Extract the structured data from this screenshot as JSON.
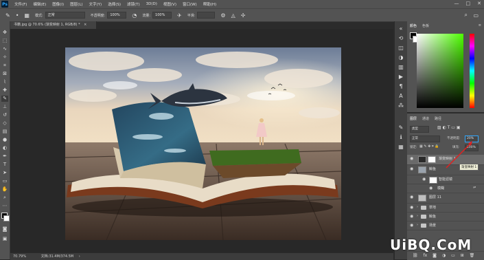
{
  "app": {
    "logo_text": "Ps"
  },
  "menu": [
    "文件(F)",
    "编辑(E)",
    "图像(I)",
    "图层(L)",
    "文字(Y)",
    "选择(S)",
    "滤镜(T)",
    "3D(D)",
    "视图(V)",
    "窗口(W)",
    "帮助(H)"
  ],
  "window_controls": [
    "—",
    "□",
    "✕"
  ],
  "options": {
    "brush_size": "•",
    "mode_label": "模式:",
    "mode_value": "正常",
    "opacity_label": "不透明度:",
    "opacity_value": "100%",
    "flow_label": "流量:",
    "flow_value": "100%",
    "smooth_label": "平滑:"
  },
  "document": {
    "tab_title": "书籍.jpg @ 70.6% (渐变映射 1, RGB/8) *",
    "zoom": "70.79%",
    "doc_size": "文档:31.4M/374.5M"
  },
  "color_panel": {
    "tabs": [
      "颜色",
      "色板"
    ]
  },
  "layers_panel": {
    "tabs": [
      "图层",
      "通道",
      "路径"
    ],
    "kind_value": "类型",
    "blend_value": "正常",
    "opacity_label": "不透明度:",
    "opacity_value": "20%",
    "lock_label": "锁定:",
    "fill_label": "填充:",
    "fill_value": "100%",
    "layers": [
      {
        "name": "渐变映射 1",
        "type": "adjustment"
      },
      {
        "name": "鲸鱼",
        "type": "layer"
      },
      {
        "name": "智能滤镜",
        "type": "filter"
      },
      {
        "name": "模糊",
        "type": "filter-item"
      },
      {
        "name": "图层 11",
        "type": "layer"
      },
      {
        "name": "草地",
        "type": "group"
      },
      {
        "name": "鲸鱼",
        "type": "group"
      },
      {
        "name": "场景",
        "type": "group"
      }
    ]
  },
  "tooltip": "渐变映射 1",
  "watermark": "UiBQ.CoM",
  "colors": {
    "accent": "#31a8ff",
    "panel": "#535353",
    "canvas_bg": "#282828"
  }
}
